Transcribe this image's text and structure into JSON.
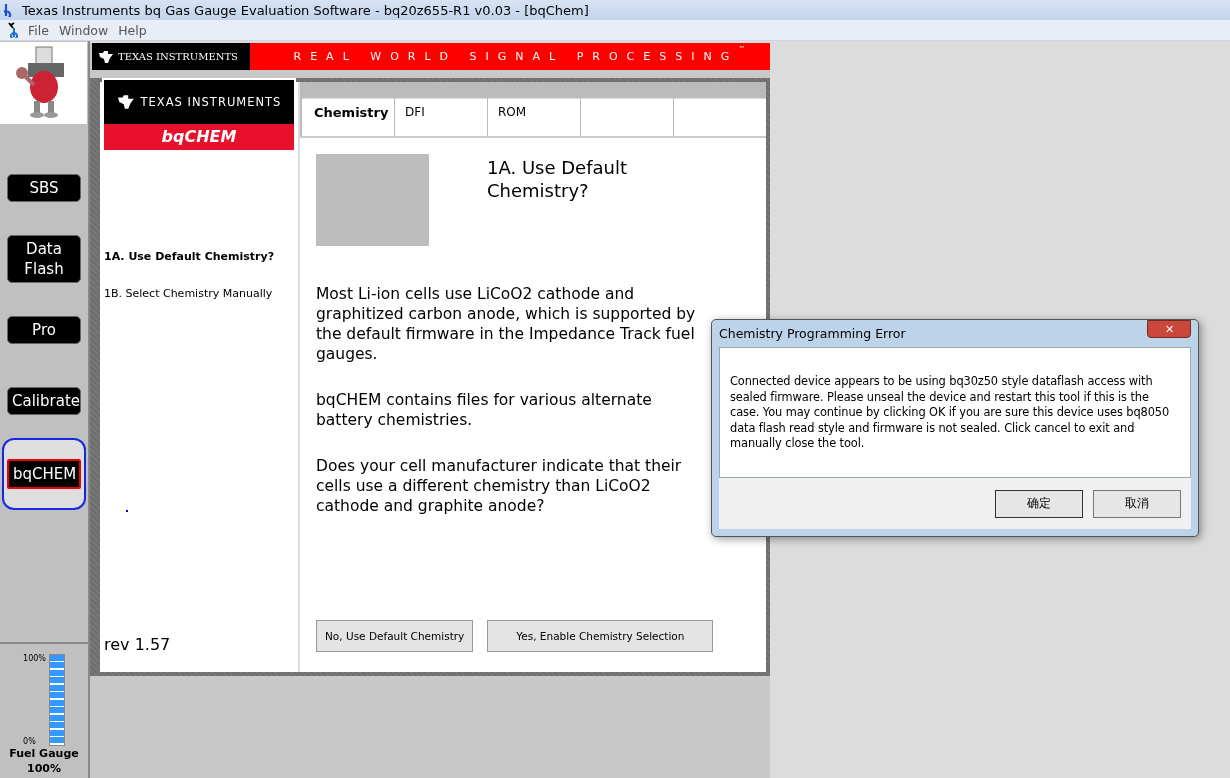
{
  "window": {
    "title": "Texas Instruments bq Gas Gauge Evaluation Software - bq20z655-R1 v0.03 - [bqChem]"
  },
  "menu": [
    "File",
    "Window",
    "Help"
  ],
  "sidebar": {
    "buttons": [
      {
        "label": "SBS",
        "selected": false
      },
      {
        "label": "Data Flash",
        "selected": false
      },
      {
        "label": "Pro",
        "selected": false
      },
      {
        "label": "Calibrate",
        "selected": false
      },
      {
        "label": "bqCHEM",
        "selected": true
      }
    ],
    "fuel_gauge": {
      "top_label": "100%",
      "bottom_label": "0%",
      "title": "Fuel Gauge",
      "reading": "100%",
      "level": 1
    }
  },
  "banner": {
    "logo": "TEXAS INSTRUMENTS",
    "slogan": "REAL WORLD SIGNAL PROCESSING",
    "trademark": "™"
  },
  "panel": {
    "logo": "TEXAS INSTRUMENTS",
    "product": "bqCHEM",
    "steps": [
      {
        "label": "1A. Use Default Chemistry?",
        "selected": true
      },
      {
        "label": "1B. Select Chemistry Manually",
        "selected": false
      }
    ],
    "revision": "rev 1.57"
  },
  "tabs": [
    {
      "label": "Chemistry",
      "selected": true
    },
    {
      "label": "DFI",
      "selected": false
    },
    {
      "label": "ROM",
      "selected": false
    }
  ],
  "content": {
    "heading": "1A. Use Default Chemistry?",
    "paragraphs": [
      "Most Li-ion cells use LiCoO2 cathode and graphitized carbon anode, which is supported by the default firmware in the Impedance Track fuel gauges.",
      "bqCHEM contains files for various alternate battery chemistries.",
      "Does your cell manufacturer indicate that their cells use a different chemistry than LiCoO2 cathode and graphite anode?"
    ],
    "buttons": [
      "No, Use Default Chemistry",
      "Yes, Enable Chemistry Selection"
    ]
  },
  "dialog": {
    "title": "Chemistry Programming Error",
    "close": "✕",
    "message": "Connected device appears to be using bq30z50 style dataflash access with sealed firmware. Please unseal the device and restart this tool if this is the case.  You may continue by clicking OK if you are sure this device uses bq8050 data flash read style and firmware is not sealed.  Click cancel to exit and manually close the tool.",
    "buttons": [
      "确定",
      "取消"
    ]
  }
}
